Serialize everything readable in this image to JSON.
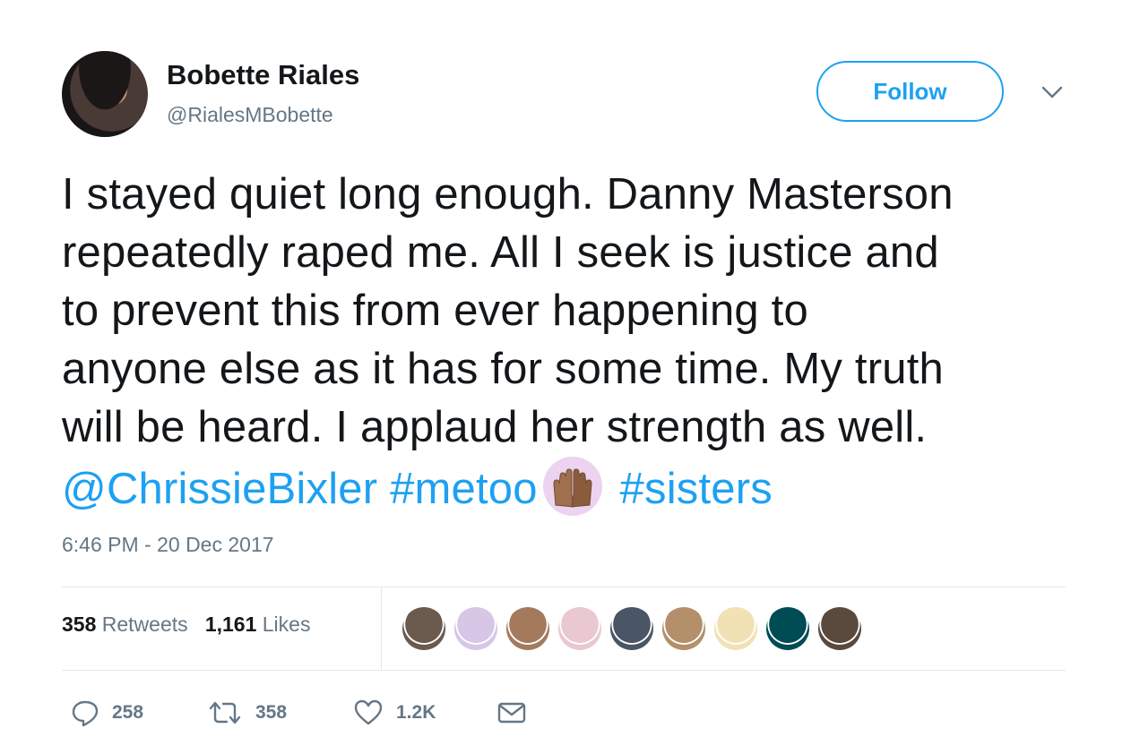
{
  "user": {
    "display_name": "Bobette Riales",
    "handle": "@RialesMBobette"
  },
  "follow_label": "Follow",
  "tweet": {
    "lines": [
      "I stayed quiet long enough. Danny Masterson",
      "repeatedly raped me. All I seek is justice and",
      "to prevent this from ever happening to",
      "anyone else as it has for some time. My truth",
      "will be heard. I applaud her strength as well."
    ],
    "mention": "@ChrissieBixler",
    "hashtag1": "#metoo",
    "emoji_icon": "raised-hands-emoji",
    "hashtag2": "#sisters"
  },
  "timestamp": "6:46 PM - 20 Dec 2017",
  "stats": {
    "retweets_count": "358",
    "retweets_label": "Retweets",
    "likes_count": "1,161",
    "likes_label": "Likes"
  },
  "likers": [
    {
      "icon": "avatar-man-beard",
      "color": "#6b5a4e"
    },
    {
      "icon": "avatar-cartoon-purple-hair",
      "color": "#d7c6e6"
    },
    {
      "icon": "avatar-woman-glasses",
      "color": "#a47a5c"
    },
    {
      "icon": "avatar-womens-place-sign",
      "color": "#e9c8cf"
    },
    {
      "icon": "avatar-dark-photo",
      "color": "#4a5565"
    },
    {
      "icon": "avatar-blonde-woman",
      "color": "#b38f6a"
    },
    {
      "icon": "avatar-light-blonde",
      "color": "#f1e2b6"
    },
    {
      "icon": "avatar-eagles-logo",
      "color": "#004c54"
    },
    {
      "icon": "avatar-group-photo",
      "color": "#5a4a3e"
    }
  ],
  "actions": {
    "reply_count": "258",
    "retweet_count": "358",
    "like_count": "1.2K"
  },
  "colors": {
    "accent": "#1da1f2",
    "text": "#14171a",
    "muted": "#657786",
    "divider": "#e1e8ed"
  }
}
